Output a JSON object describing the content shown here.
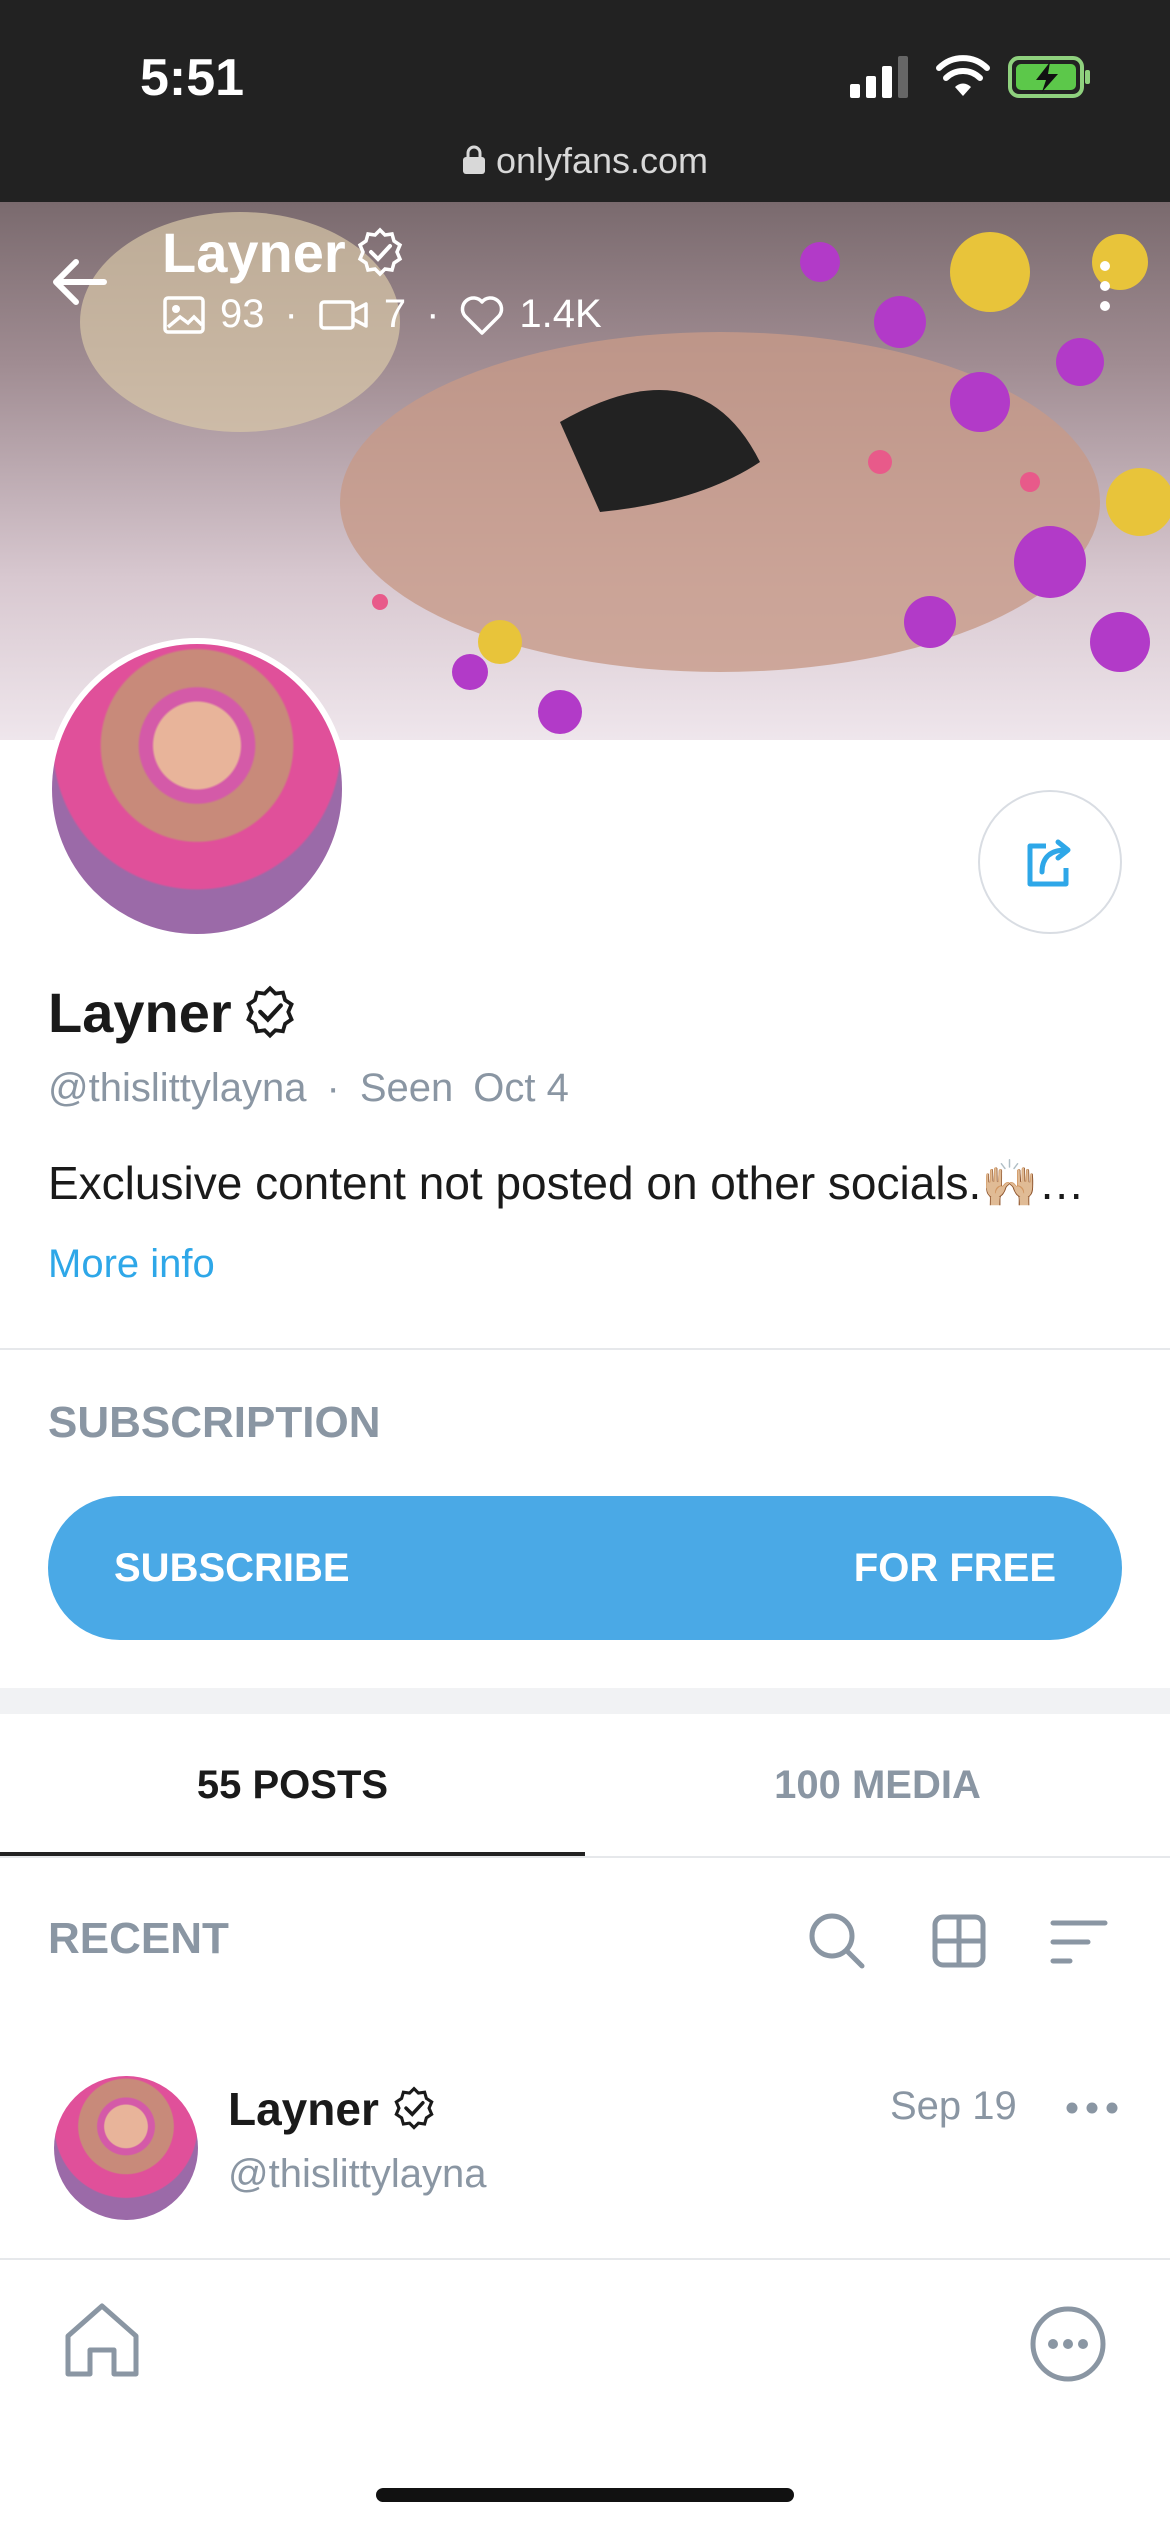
{
  "status_bar": {
    "time": "5:51",
    "url": "onlyfans.com"
  },
  "cover": {
    "name": "Layner",
    "photos_count": "93",
    "videos_count": "7",
    "likes_count": "1.4K"
  },
  "profile": {
    "name": "Layner",
    "handle": "@thislittylayna",
    "seen_label": "Seen",
    "seen_date": "Oct 4",
    "bio": "Exclusive content not posted on other socials.🙌🏼…",
    "more_info": "More info"
  },
  "subscription": {
    "section_label": "SUBSCRIPTION",
    "button_label": "SUBSCRIBE",
    "price_label": "FOR FREE"
  },
  "tabs": [
    {
      "label": "55 POSTS",
      "active": true
    },
    {
      "label": "100 MEDIA",
      "active": false
    }
  ],
  "feed": {
    "section_label": "RECENT",
    "post": {
      "name": "Layner",
      "handle": "@thislittylayna",
      "date": "Sep 19"
    }
  },
  "colors": {
    "accent": "#4aa9e6",
    "link": "#2ea7e8",
    "muted": "#8a96a3",
    "status_bg": "#222222"
  }
}
